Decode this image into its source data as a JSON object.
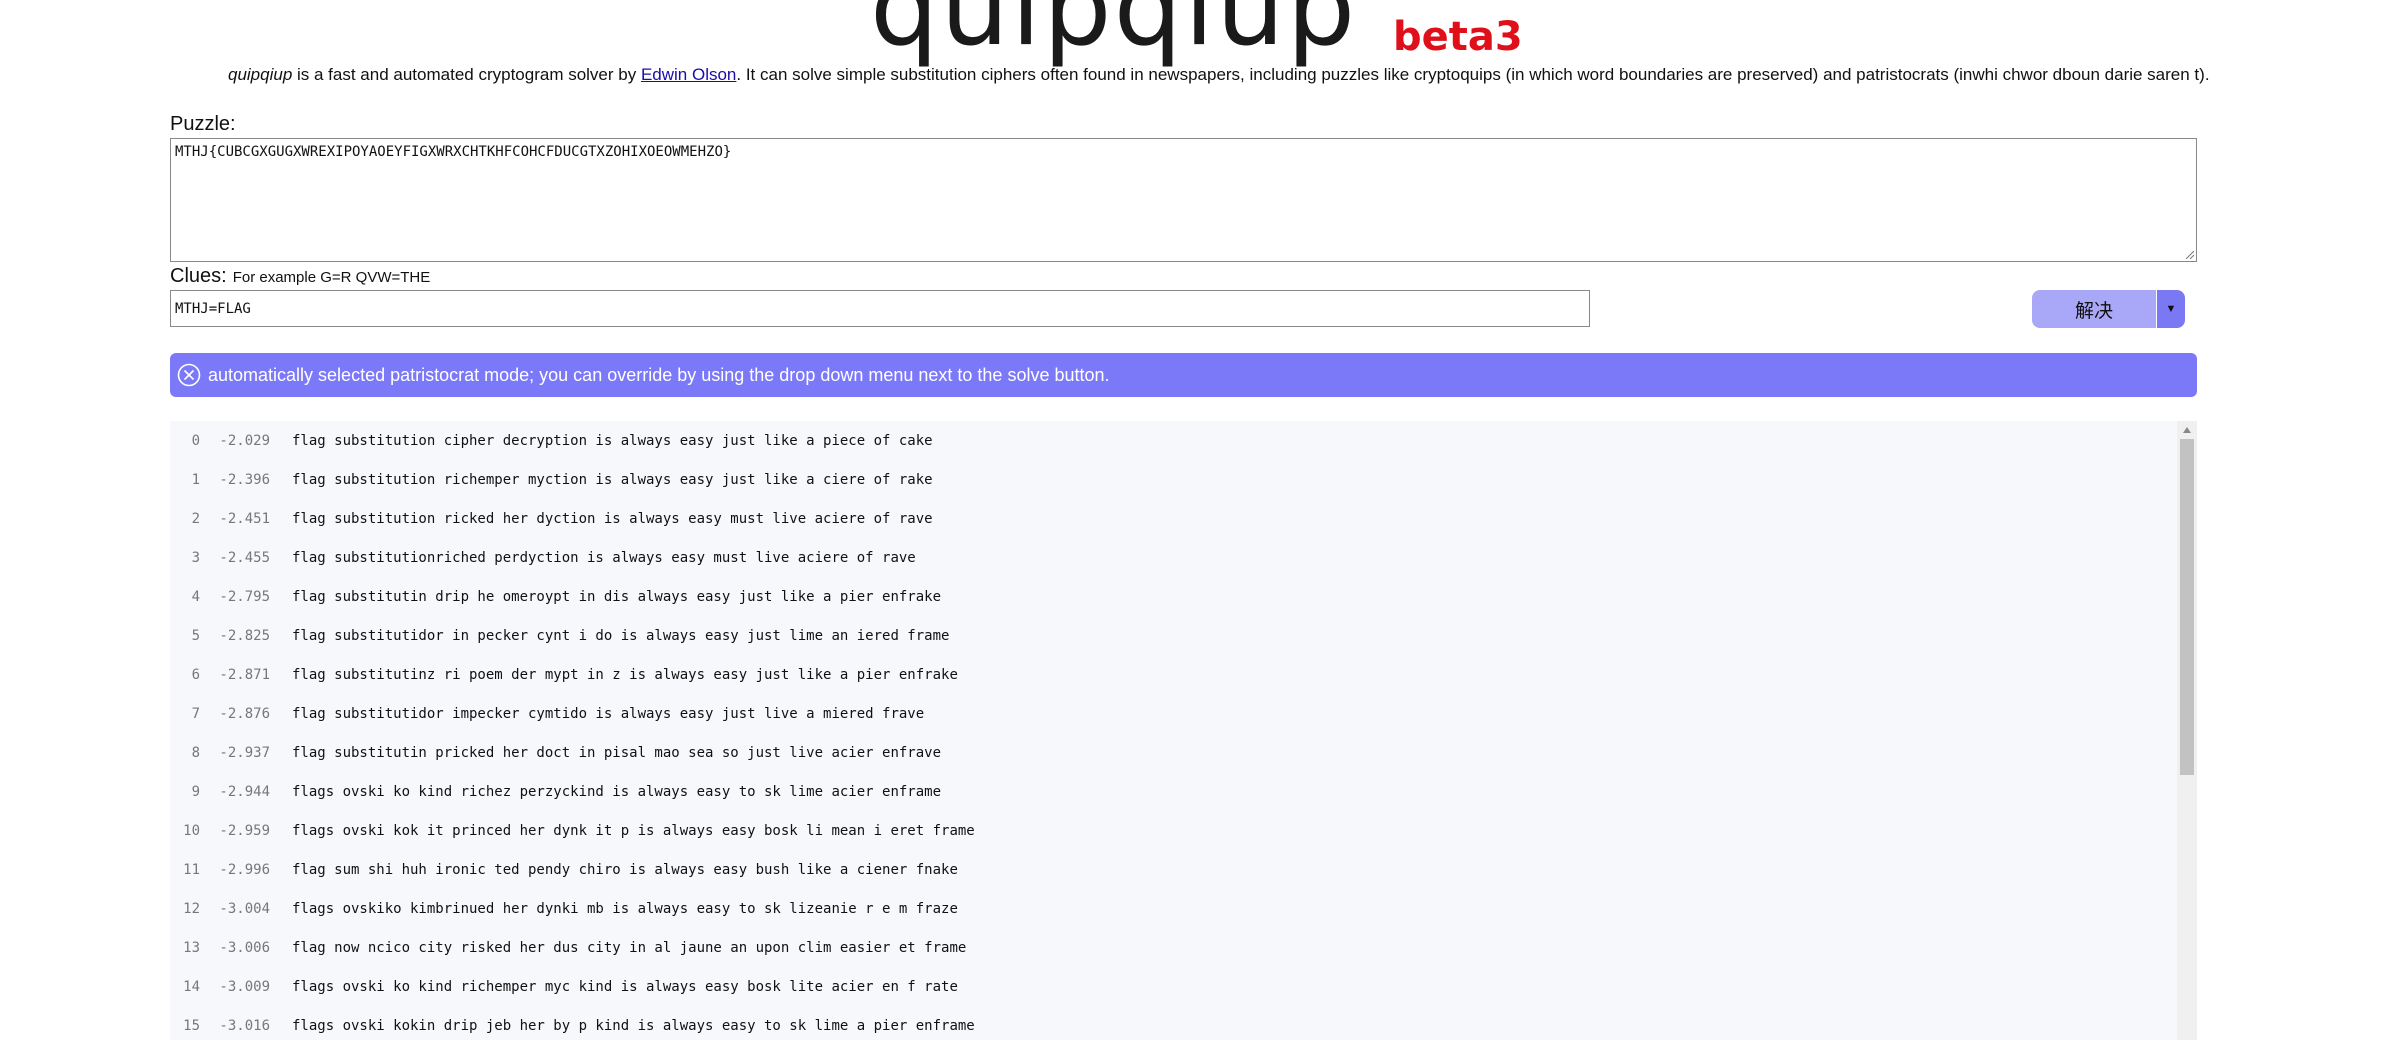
{
  "header": {
    "logo": "quipqiup",
    "beta": "beta3",
    "intro_name": "quipqiup",
    "intro_mid": " is a fast and automated cryptogram solver by ",
    "author_link": "Edwin Olson",
    "intro_rest": ". It can solve simple substitution ciphers often found in newspapers, including puzzles like cryptoquips (in which word boundaries are preserved) and patristocrats (inwhi chwor dboun darie saren t)."
  },
  "puzzle": {
    "label": "Puzzle:",
    "value": "MTHJ{CUBCGXGUGXWREXIPOYAOEYFIGXWRXCHTKHFCOHCFDUCGTXZOHIXOEOWMEHZO}"
  },
  "clues": {
    "label": "Clues:",
    "hint": "For example G=R QVW=THE",
    "value": "MTHJ=FLAG"
  },
  "solve": {
    "label": "解决",
    "dropdown": "▼"
  },
  "banner": {
    "message": "automatically selected patristocrat mode; you can override by using the drop down menu next to the solve button."
  },
  "results": [
    {
      "idx": "0",
      "score": "-2.029",
      "text": "flag substitution cipher decryption is always easy just like a piece of cake"
    },
    {
      "idx": "1",
      "score": "-2.396",
      "text": "flag substitution richemper myction is always easy just like a ciere of rake"
    },
    {
      "idx": "2",
      "score": "-2.451",
      "text": "flag substitution ricked her dyction is always easy must live aciere of rave"
    },
    {
      "idx": "3",
      "score": "-2.455",
      "text": "flag substitutionriched perdyction is always easy must live aciere of rave"
    },
    {
      "idx": "4",
      "score": "-2.795",
      "text": "flag substitutin drip he omeroypt in dis always easy just like a pier enfrake"
    },
    {
      "idx": "5",
      "score": "-2.825",
      "text": "flag substitutidor in pecker cynt i do is always easy just lime an iered frame"
    },
    {
      "idx": "6",
      "score": "-2.871",
      "text": "flag substitutinz ri poem der mypt in z is always easy just like a pier enfrake"
    },
    {
      "idx": "7",
      "score": "-2.876",
      "text": "flag substitutidor impecker cymtido is always easy just live a miered frave"
    },
    {
      "idx": "8",
      "score": "-2.937",
      "text": "flag substitutin pricked her doct in pisal mao sea so just live acier enfrave"
    },
    {
      "idx": "9",
      "score": "-2.944",
      "text": "flags ovski ko kind richez perzyckind is always easy to sk lime acier enframe"
    },
    {
      "idx": "10",
      "score": "-2.959",
      "text": "flags ovski kok it princed her dynk it p is always easy bosk li mean i eret frame"
    },
    {
      "idx": "11",
      "score": "-2.996",
      "text": "flag sum shi huh ironic ted pendy chiro is always easy bush like a ciener fnake"
    },
    {
      "idx": "12",
      "score": "-3.004",
      "text": "flags ovskiko kimbrinued her dynki mb is always easy to sk lizeanie r e m fraze"
    },
    {
      "idx": "13",
      "score": "-3.006",
      "text": "flag now ncico city risked her dus city in al jaune an upon clim easier et frame"
    },
    {
      "idx": "14",
      "score": "-3.009",
      "text": "flags ovski ko kind richemper myc kind is always easy bosk lite acier en f rate"
    },
    {
      "idx": "15",
      "score": "-3.016",
      "text": "flags ovski kokin drip jeb her by p kind is always easy to sk lime a pier enframe"
    }
  ],
  "colors": {
    "accent": "#7b79f7",
    "solve_button": "#a9a7f7",
    "beta": "#e0101a",
    "link": "#1a0dab"
  },
  "icons": {
    "banner_close": "close-circle-icon",
    "scroll_up": "triangle-up-icon"
  }
}
